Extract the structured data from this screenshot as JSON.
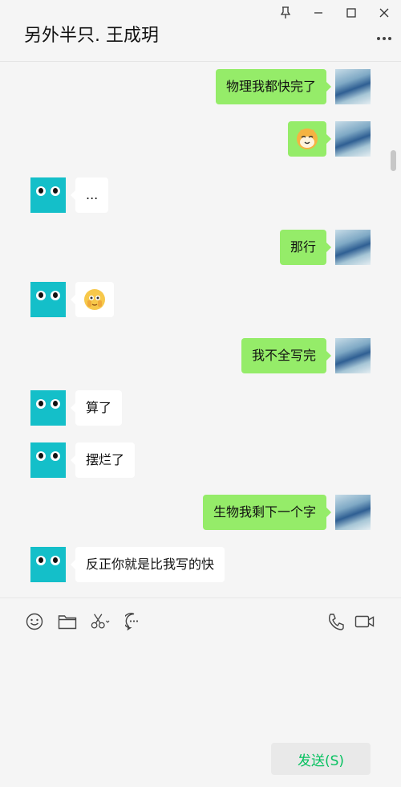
{
  "header": {
    "title": "另外半只. 王成玥"
  },
  "window_controls": [
    {
      "name": "pin-icon"
    },
    {
      "name": "minimize-icon"
    },
    {
      "name": "maximize-icon"
    },
    {
      "name": "close-icon"
    }
  ],
  "messages": [
    {
      "sender": "me",
      "text": "物理我都快完了"
    },
    {
      "sender": "me",
      "emoji": "cat-face-emoji"
    },
    {
      "sender": "other",
      "text": "..."
    },
    {
      "sender": "me",
      "text": "那行"
    },
    {
      "sender": "other",
      "emoji": "peeking-face-emoji"
    },
    {
      "sender": "me",
      "text": "我不全写完"
    },
    {
      "sender": "other",
      "text": "算了"
    },
    {
      "sender": "other",
      "text": "摆烂了"
    },
    {
      "sender": "me",
      "text": "生物我剩下一个字"
    },
    {
      "sender": "other",
      "text": "反正你就是比我写的快"
    }
  ],
  "toolbar": {
    "icons": [
      "emoji-icon",
      "folder-icon",
      "scissors-icon",
      "chat-history-icon",
      "phone-icon",
      "video-call-icon"
    ]
  },
  "send_button": {
    "label": "发送(S)"
  },
  "colors": {
    "my_bubble": "#95ec69",
    "other_bubble": "#ffffff",
    "background": "#f5f5f5",
    "send_text": "#07c160",
    "other_avatar": "#14bfc9"
  }
}
